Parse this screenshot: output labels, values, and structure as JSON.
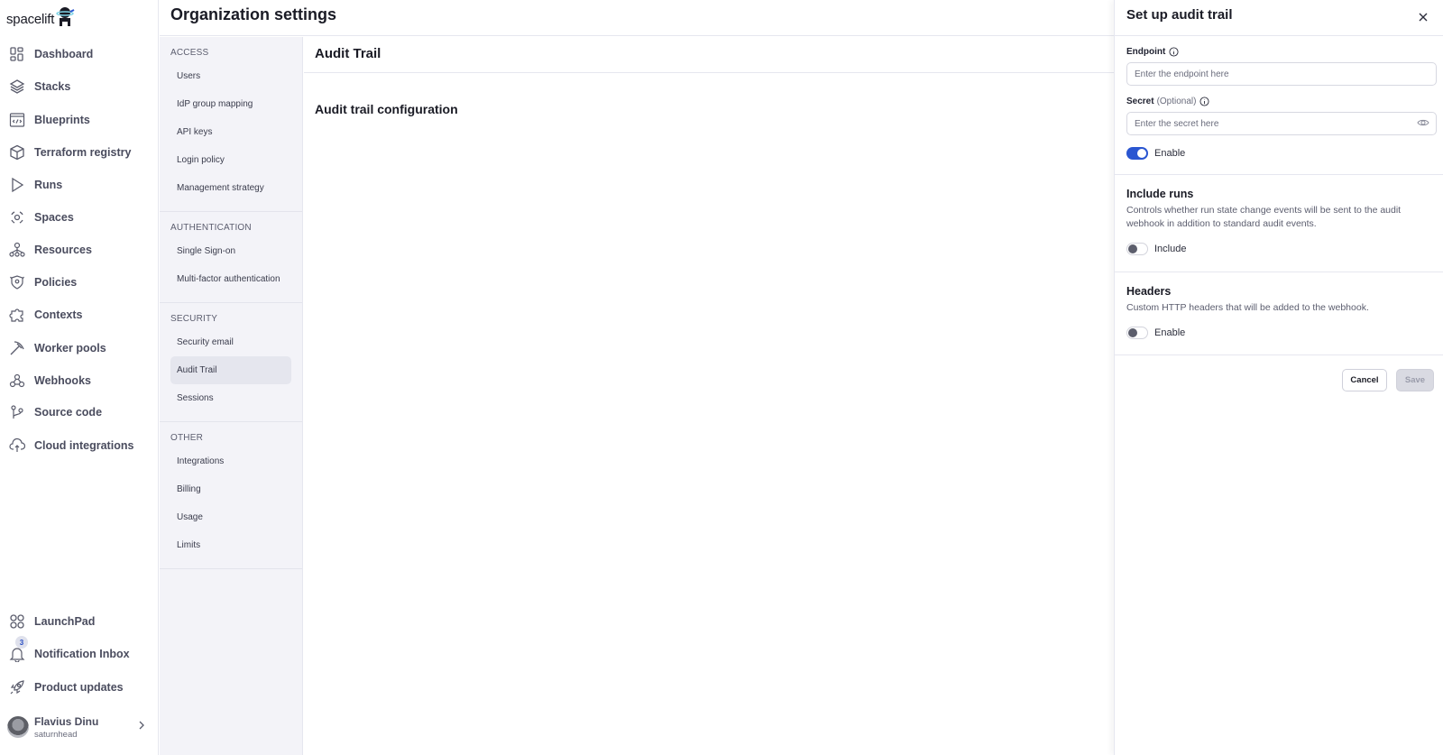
{
  "brand": {
    "name": "spacelift"
  },
  "nav": {
    "items": [
      {
        "label": "Dashboard",
        "icon": "dashboard-icon"
      },
      {
        "label": "Stacks",
        "icon": "stacks-icon"
      },
      {
        "label": "Blueprints",
        "icon": "blueprints-icon"
      },
      {
        "label": "Terraform registry",
        "icon": "cube-icon"
      },
      {
        "label": "Runs",
        "icon": "play-icon"
      },
      {
        "label": "Spaces",
        "icon": "spaces-icon"
      },
      {
        "label": "Resources",
        "icon": "resources-icon"
      },
      {
        "label": "Policies",
        "icon": "policies-icon"
      },
      {
        "label": "Contexts",
        "icon": "puzzle-icon"
      },
      {
        "label": "Worker pools",
        "icon": "pickaxe-icon"
      },
      {
        "label": "Webhooks",
        "icon": "webhooks-icon"
      },
      {
        "label": "Source code",
        "icon": "git-branch-icon"
      },
      {
        "label": "Cloud integrations",
        "icon": "cloud-upload-icon"
      }
    ],
    "bottom": [
      {
        "label": "LaunchPad",
        "icon": "launchpad-icon"
      },
      {
        "label": "Notification Inbox",
        "icon": "bell-icon",
        "badge": "3"
      },
      {
        "label": "Product updates",
        "icon": "rocket-icon"
      }
    ],
    "user": {
      "name": "Flavius Dinu",
      "handle": "saturnhead"
    }
  },
  "header": {
    "title": "Organization settings"
  },
  "subnav": {
    "groups": [
      {
        "title": "ACCESS",
        "items": [
          "Users",
          "IdP group mapping",
          "API keys",
          "Login policy",
          "Management strategy"
        ]
      },
      {
        "title": "AUTHENTICATION",
        "items": [
          "Single Sign-on",
          "Multi-factor authentication"
        ]
      },
      {
        "title": "SECURITY",
        "items": [
          "Security email",
          "Audit Trail",
          "Sessions"
        ]
      },
      {
        "title": "OTHER",
        "items": [
          "Integrations",
          "Billing",
          "Usage",
          "Limits"
        ]
      }
    ],
    "active": "Audit Trail"
  },
  "main": {
    "title": "Audit Trail",
    "section_title": "Audit trail configuration"
  },
  "drawer": {
    "title": "Set up audit trail",
    "endpoint": {
      "label": "Endpoint",
      "placeholder": "Enter the endpoint here",
      "value": ""
    },
    "secret": {
      "label": "Secret",
      "optional": "(Optional)",
      "placeholder": "Enter the secret here",
      "value": ""
    },
    "enable": {
      "label": "Enable",
      "on": true
    },
    "include_runs": {
      "title": "Include runs",
      "description": "Controls whether run state change events will be sent to the audit webhook in addition to standard audit events.",
      "toggle_label": "Include",
      "on": false
    },
    "headers": {
      "title": "Headers",
      "description": "Custom HTTP headers that will be added to the webhook.",
      "toggle_label": "Enable",
      "on": false
    },
    "cancel_label": "Cancel",
    "save_label": "Save"
  },
  "colors": {
    "accent": "#2a56d1",
    "sidebar_bg": "#f3f3f8",
    "text": "#1a1b25"
  }
}
